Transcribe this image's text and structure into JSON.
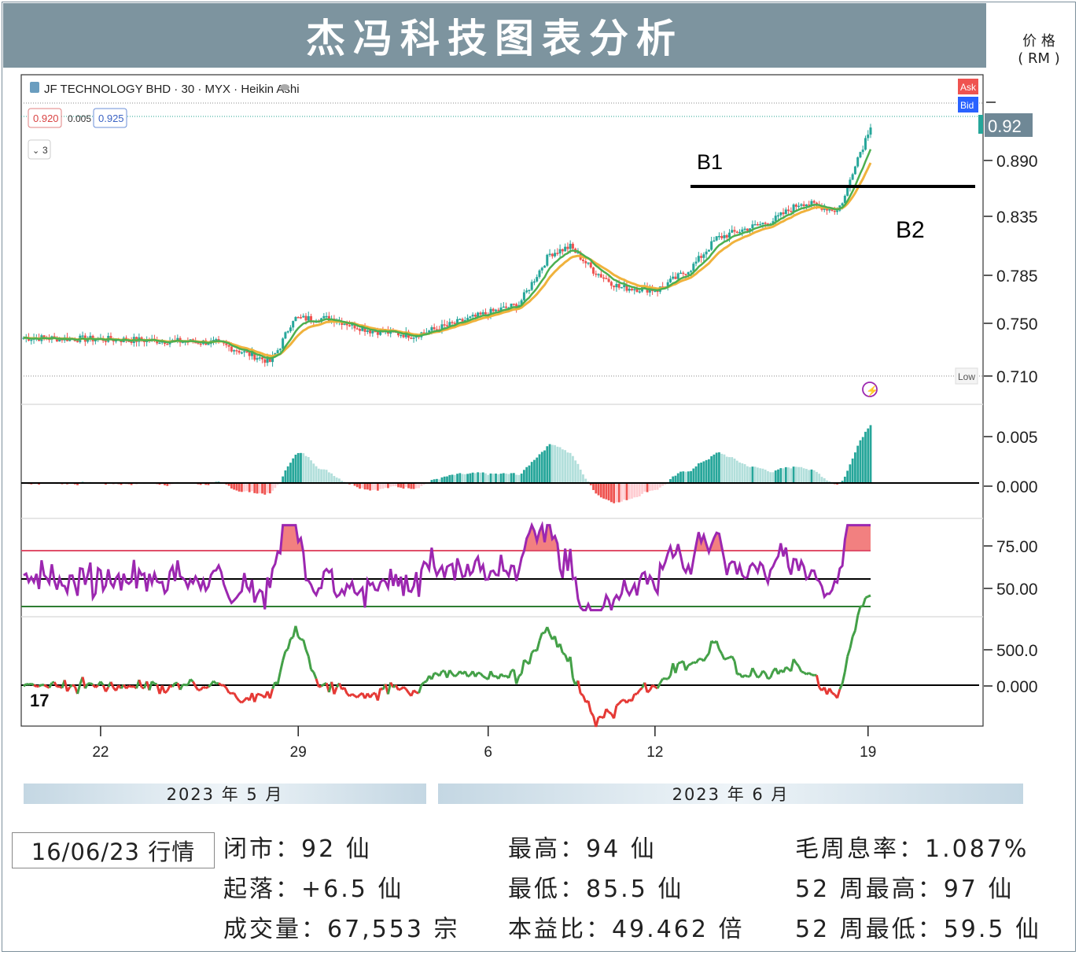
{
  "header": {
    "title": "杰冯科技图表分析",
    "price_unit": "价 格",
    "price_unit_sub": "( RM )"
  },
  "chart_header": {
    "symbol_line": "JF TECHNOLOGY BHD · 30 · MYX · Heikin Ashi",
    "bid_price": "0.920",
    "spread": "0.005",
    "ask_price": "0.925",
    "collapse_label": "3",
    "ask_tag": "Ask",
    "bid_tag": "Bid",
    "low_tag": "Low",
    "last_price": "0.92",
    "logo": "17"
  },
  "annotations": {
    "b1": "B1",
    "b2": "B2"
  },
  "axes": {
    "price_ticks": [
      "0.890",
      "0.835",
      "0.785",
      "0.750",
      "0.710"
    ],
    "macd_ticks": [
      "0.005",
      "0.000"
    ],
    "rsi_ticks": [
      "75.00",
      "50.00"
    ],
    "cci_ticks": [
      "500.0",
      "0.000"
    ],
    "x_ticks": [
      "22",
      "29",
      "6",
      "12",
      "19"
    ]
  },
  "months": {
    "may": "2023 年 5 月",
    "june": "2023 年 6 月"
  },
  "info": {
    "date_label": "16/06/23 行情",
    "close": "闭市：92 仙",
    "change": "起落：+6.5 仙",
    "volume": "成交量：67,553 宗",
    "high": "最高：94 仙",
    "low": "最低：85.5 仙",
    "pe": "本益比：49.462 倍",
    "dividend_yield": "毛周息率：1.087%",
    "high_52w": "52 周最高：97 仙",
    "low_52w": "52 周最低：59.5 仙"
  },
  "colors": {
    "up": "#26a69a",
    "down": "#ef5350",
    "ma_fast": "#4caf50",
    "ma_slow": "#f0b23c",
    "rsi": "#9c27b0",
    "title_bg": "#7d949f"
  },
  "chart_data": {
    "type": "line",
    "price_series_keypoints": [
      [
        0,
        0.742
      ],
      [
        45,
        0.74
      ],
      [
        75,
        0.738
      ],
      [
        96,
        0.722
      ],
      [
        100,
        0.735
      ],
      [
        105,
        0.758
      ],
      [
        120,
        0.758
      ],
      [
        135,
        0.748
      ],
      [
        152,
        0.744
      ],
      [
        165,
        0.752
      ],
      [
        180,
        0.762
      ],
      [
        193,
        0.77
      ],
      [
        205,
        0.812
      ],
      [
        213,
        0.818
      ],
      [
        222,
        0.798
      ],
      [
        232,
        0.784
      ],
      [
        247,
        0.782
      ],
      [
        260,
        0.8
      ],
      [
        270,
        0.825
      ],
      [
        280,
        0.832
      ],
      [
        292,
        0.84
      ],
      [
        303,
        0.855
      ],
      [
        310,
        0.852
      ],
      [
        317,
        0.848
      ],
      [
        320,
        0.86
      ],
      [
        324,
        0.888
      ],
      [
        327,
        0.902
      ],
      [
        330,
        0.92
      ]
    ],
    "price_range": [
      0.705,
      0.925
    ],
    "bar_count": 331,
    "reference_line_b1": 0.865,
    "last_price": 0.92,
    "macd_range": [
      -0.0025,
      0.0085
    ],
    "rsi_levels": [
      70,
      50,
      30
    ],
    "rsi_range": [
      20,
      90
    ],
    "cci_range": [
      -300,
      700
    ],
    "x_tick_positions": [
      30,
      107,
      181,
      246,
      329
    ]
  }
}
